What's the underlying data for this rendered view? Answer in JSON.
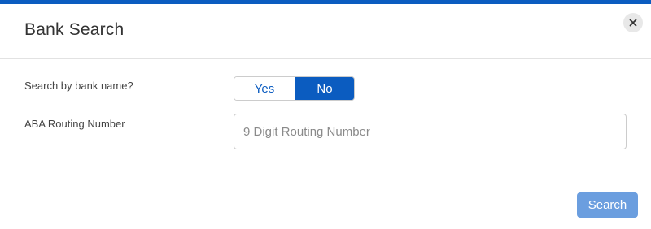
{
  "modal": {
    "title": "Bank Search",
    "close_icon": "close-icon"
  },
  "form": {
    "bank_name_label": "Search by bank name?",
    "toggle": {
      "yes_label": "Yes",
      "no_label": "No",
      "selected": "No"
    },
    "aba_label": "ABA Routing Number",
    "routing_input": {
      "value": "",
      "placeholder": "9 Digit Routing Number"
    }
  },
  "footer": {
    "search_label": "Search"
  },
  "colors": {
    "accent": "#0b5cc0",
    "search_button": "#6b9edf",
    "close_button_bg": "#e8e8e8"
  }
}
